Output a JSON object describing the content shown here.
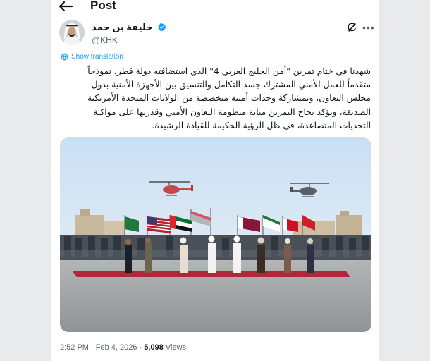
{
  "header": {
    "title": "Post"
  },
  "tweet": {
    "author": {
      "display_name": "خليفة بن حمد",
      "handle": "@KHK"
    },
    "show_translation_label": "Show translation",
    "text": "شهدنا في ختام تمرين \"أمن الخليج العربي 4\" الذي استضافته دولة قطر، نموذجاً متقدماً للعمل الأمني المشترك جسد التكامل والتنسيق بين الأجهزة الأمنية بدول مجلس التعاون، وبمشاركة وحدات أمنية متخصصة من الولايات المتحدة الأمريكية الصديقة، ويؤكد نجاح التمرين متانة منظومة التعاون الأمني وقدرتها على مواكبة التحديات المتصاعدة، في ظل الرؤية الحكيمة للقيادة الرشيدة.",
    "meta": {
      "time": "2:52 PM",
      "separator": "·",
      "date": "Feb 4, 2026",
      "views_count": "5,098",
      "views_label": "Views"
    }
  },
  "icons": {
    "back": "arrow-left-icon",
    "verified": "verified-badge-icon",
    "grok": "grok-icon",
    "more": "more-icon",
    "translate": "globe-icon"
  },
  "colors": {
    "accent": "#1d9bf0",
    "text_primary": "#0f1419",
    "text_secondary": "#536471",
    "background": "#ffffff",
    "outer_background": "#e9eaeb"
  }
}
